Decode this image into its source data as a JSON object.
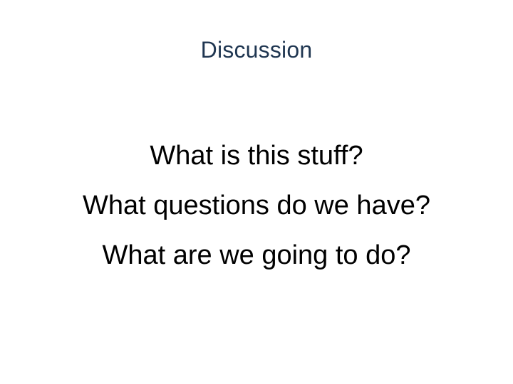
{
  "slide": {
    "title": "Discussion",
    "lines": [
      "What is this stuff?",
      "What questions do we have?",
      "What are we going to do?"
    ]
  },
  "colors": {
    "title": "#1f3651",
    "body": "#000000",
    "background": "#ffffff"
  }
}
